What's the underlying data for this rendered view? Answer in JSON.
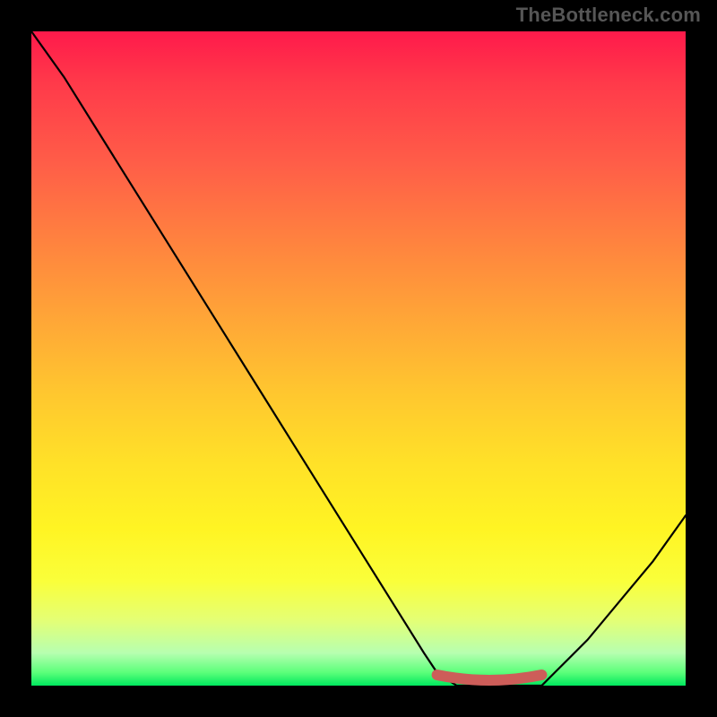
{
  "watermark": "TheBottleneck.com",
  "colors": {
    "flat_segment": "#cd5d59",
    "curve": "#000000"
  },
  "chart_data": {
    "type": "line",
    "title": "",
    "xlabel": "",
    "ylabel": "",
    "xlim": [
      0,
      100
    ],
    "ylim": [
      0,
      100
    ],
    "grid": false,
    "series": [
      {
        "name": "bottleneck_curve",
        "x": [
          0,
          5,
          10,
          15,
          20,
          25,
          30,
          35,
          40,
          45,
          50,
          55,
          60,
          62,
          65,
          70,
          75,
          78,
          80,
          85,
          90,
          95,
          100
        ],
        "y": [
          100,
          93,
          85,
          77,
          69,
          61,
          53,
          45,
          37,
          29,
          21,
          13,
          5,
          2,
          0,
          0,
          0,
          0,
          2,
          7,
          13,
          19,
          26
        ]
      }
    ],
    "flat_segment": {
      "x_start": 62,
      "x_end": 78,
      "y": 0
    }
  }
}
